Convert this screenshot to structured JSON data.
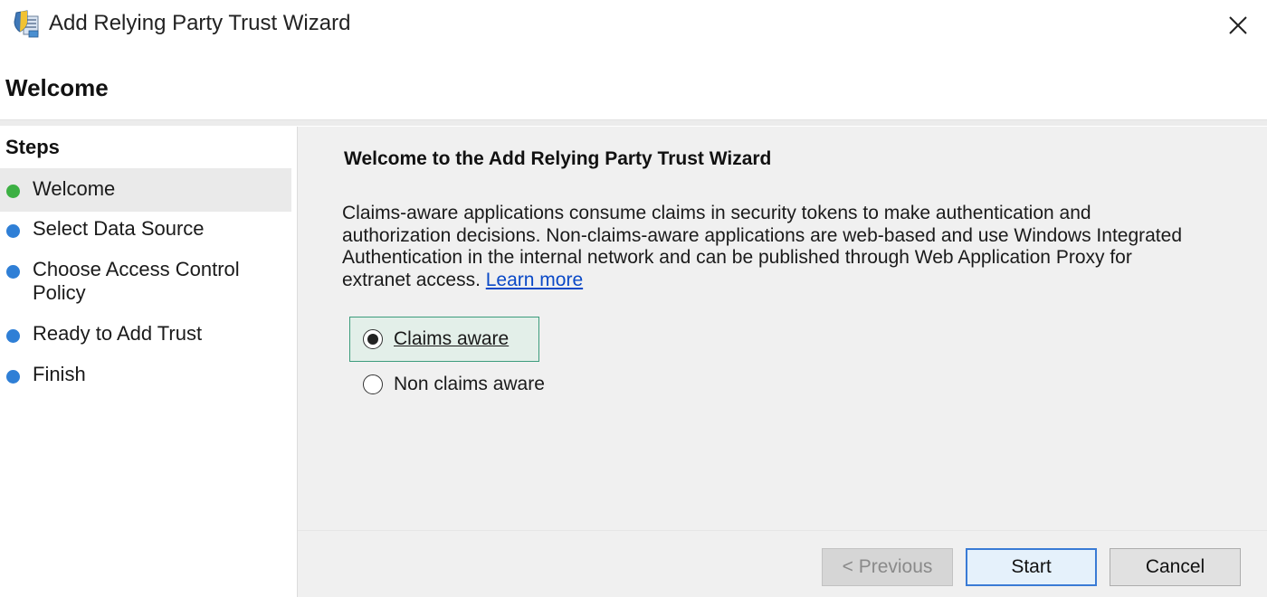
{
  "window": {
    "title": "Add Relying Party Trust Wizard"
  },
  "header": {
    "title": "Welcome"
  },
  "sidebar": {
    "title": "Steps",
    "items": [
      {
        "label": "Welcome",
        "status_color": "#3cb043",
        "active": true
      },
      {
        "label": "Select Data Source",
        "status_color": "#2f7fd6",
        "active": false
      },
      {
        "label": "Choose Access Control Policy",
        "status_color": "#2f7fd6",
        "active": false
      },
      {
        "label": "Ready to Add Trust",
        "status_color": "#2f7fd6",
        "active": false
      },
      {
        "label": "Finish",
        "status_color": "#2f7fd6",
        "active": false
      }
    ]
  },
  "main": {
    "title": "Welcome to the Add Relying Party Trust Wizard",
    "description": "Claims-aware applications consume claims in security tokens to make authentication and authorization decisions. Non-claims-aware applications are web-based and use Windows Integrated Authentication in the internal network and can be published through Web Application Proxy for extranet access.",
    "learn_more": "Learn more",
    "options": [
      {
        "label": "Claims aware",
        "selected": true
      },
      {
        "label": "Non claims aware",
        "selected": false
      }
    ]
  },
  "buttons": {
    "previous": "< Previous",
    "start": "Start",
    "cancel": "Cancel"
  },
  "icons": {
    "app": "relying-party-trust-icon",
    "close": "close-icon"
  },
  "colors": {
    "focus_border": "#3c9c7c",
    "link": "#0a49c7",
    "primary_button_border": "#3a7bd5"
  }
}
